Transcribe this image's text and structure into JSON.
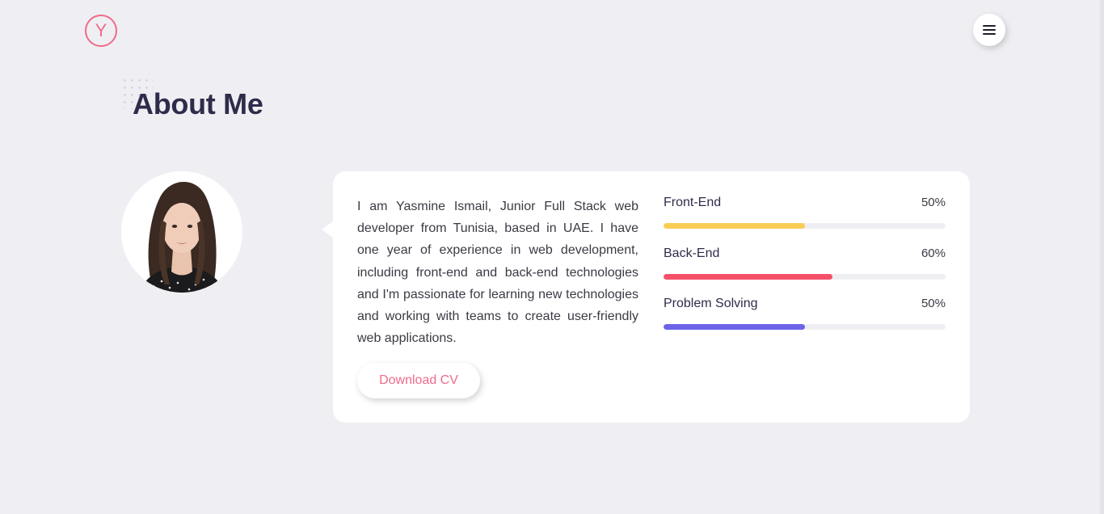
{
  "header": {
    "logo_letter": "Y",
    "menu_icon": "hamburger-icon"
  },
  "about": {
    "title": "About Me",
    "bio": "I am Yasmine Ismail, Junior Full Stack web developer from Tunisia, based in UAE. I have one year of experience in web development, including front-end and back-end technologies and I'm passionate for learning new technologies and working with teams to create user-friendly web applications.",
    "download_label": "Download CV"
  },
  "skills": [
    {
      "name": "Front-End",
      "percent_label": "50%",
      "value": 0.5,
      "color": "#f9ce55"
    },
    {
      "name": "Back-End",
      "percent_label": "60%",
      "value": 0.6,
      "color": "#f5506a"
    },
    {
      "name": "Problem Solving",
      "percent_label": "50%",
      "value": 0.5,
      "color": "#6c63e8"
    }
  ],
  "colors": {
    "accent": "#f06a8a",
    "background": "#efeff3",
    "heading": "#2e2c4a"
  }
}
